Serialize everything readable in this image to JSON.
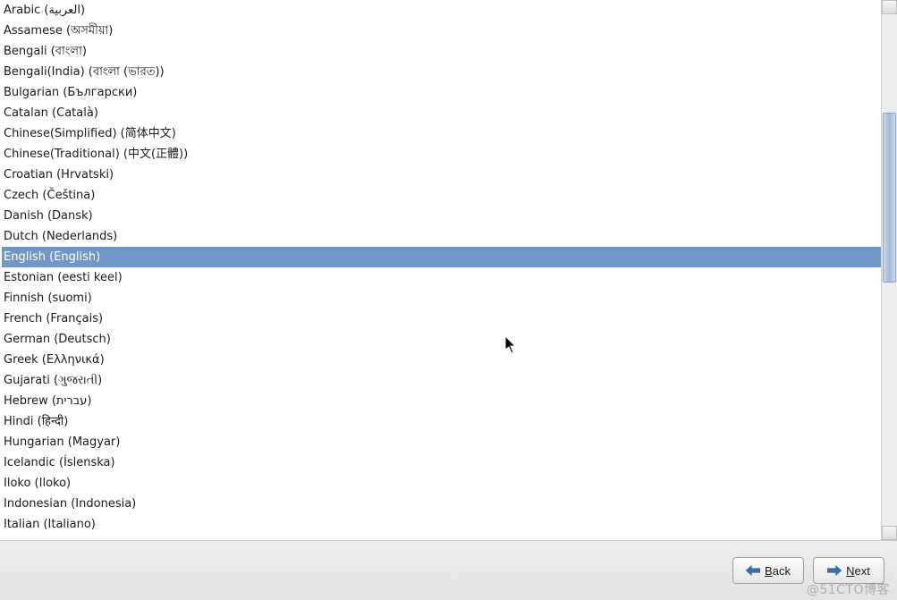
{
  "selected_index": 13,
  "languages": [
    "Arabic (العربية)",
    "Assamese (অসমীয়া)",
    "Bengali (বাংলা)",
    "Bengali(India) (বাংলা (ভারত))",
    "Bulgarian (Български)",
    "Catalan (Català)",
    "Chinese(Simplified) (简体中文)",
    "Chinese(Traditional) (中文(正體))",
    "Croatian (Hrvatski)",
    "Czech (Čeština)",
    "Danish (Dansk)",
    "Dutch (Nederlands)",
    "English (English)",
    "Estonian (eesti keel)",
    "Finnish (suomi)",
    "French (Français)",
    "German (Deutsch)",
    "Greek (Ελληνικά)",
    "Gujarati (ગુજરાતી)",
    "Hebrew (עברית)",
    "Hindi (हिन्दी)",
    "Hungarian (Magyar)",
    "Icelandic (Íslenska)",
    "Iloko (Iloko)",
    "Indonesian (Indonesia)",
    "Italian (Italiano)"
  ],
  "buttons": {
    "back": {
      "label": "Back",
      "accel": "B"
    },
    "next": {
      "label": "Next",
      "accel": "N"
    }
  },
  "watermark": "@51CTO博客"
}
